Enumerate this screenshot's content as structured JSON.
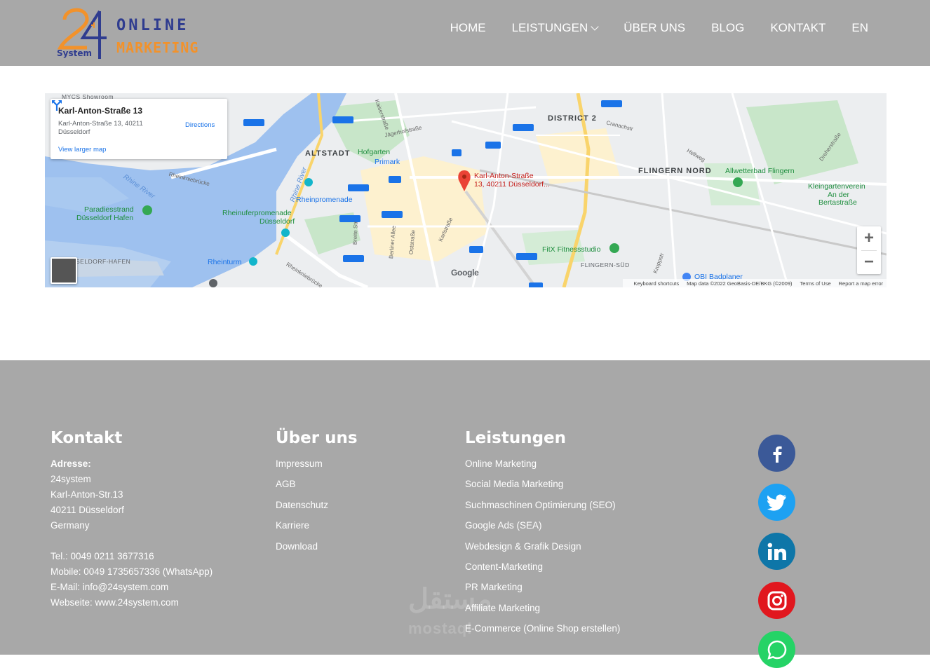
{
  "header": {
    "logo": {
      "online": "ONLINE",
      "marketing": "MARKETING",
      "system": "System",
      "number": "24"
    },
    "nav": [
      {
        "label": "HOME"
      },
      {
        "label": "LEISTUNGEN"
      },
      {
        "label": "ÜBER UNS"
      },
      {
        "label": "BLOG"
      },
      {
        "label": "KONTAKT"
      },
      {
        "label": "EN"
      }
    ]
  },
  "map": {
    "card": {
      "title": "Karl-Anton-Straße 13",
      "address_line1": "Karl-Anton-Straße 13, 40211",
      "address_line2": "Düsseldorf",
      "larger_map": "View larger map",
      "directions": "Directions"
    },
    "pin_label_1": "Karl-Anton-Straße",
    "pin_label_2": "13, 40211 Düsseldorf...",
    "labels": {
      "district2": "DISTRICT 2",
      "altstadt": "ALTSTADT",
      "flingern_nord": "FLINGERN NORD",
      "flingern_sud": "FLINGERN-SÜD",
      "hofgarten": "Hofgarten",
      "primark": "Primark",
      "rheinpromenade": "Rheinpromenade",
      "rheinuferpromenade_1": "Rheinuferpromenade",
      "rheinuferpromenade_2": "Düsseldorf",
      "paradiesstrand_1": "Paradiesstrand",
      "paradiesstrand_2": "Düsseldorf Hafen",
      "rheinturm": "Rheinturm",
      "allwetterbad": "Allwetterbad Flingern",
      "kleingarten_1": "Kleingartenverein",
      "kleingarten_2": "An der",
      "kleingarten_3": "Bertastraße",
      "fitx": "FitX Fitnessstudio",
      "obi": "OBI Badplaner",
      "rhine_river": "Rhine River",
      "rhine_river_2": "Rhine River",
      "hafen": "SELDORF-HAFEN",
      "mycs": "MYCS Showroom",
      "rheinkniebrucke": "Rheinkniebrücke",
      "rheinkniebrucke_2": "Rheinkniebrücke",
      "karlstrasse": "Karlstraße",
      "berliner_allee": "Berliner Allee",
      "oststrasse": "Oststraße",
      "breite_str": "Breite Str",
      "jaegerhof": "Jägerhofstraße",
      "kaiserstrasse": "Kaiserstraße",
      "cranachstr": "Cranachstr",
      "hellweg": "Hellweg",
      "dreherstrasse": "Dreherstraße",
      "kruppstr": "Kruppstr"
    },
    "zoom_in": "+",
    "zoom_out": "−",
    "google": "Google",
    "footer": [
      "Keyboard shortcuts",
      "Map data ©2022 GeoBasis-DE/BKG (©2009)",
      "Terms of Use",
      "Report a map error"
    ]
  },
  "footer": {
    "kontakt": {
      "heading": "Kontakt",
      "address_label": "Adresse:",
      "company": "24system",
      "street": "Karl-Anton-Str.13",
      "city": "40211 Düsseldorf",
      "country": "Germany",
      "tel": "Tel.: 0049 0211 3677316",
      "mobile": "Mobile: 0049 1735657336 (WhatsApp)",
      "email": "E-Mail: info@24system.com",
      "website": "Webseite: www.24system.com"
    },
    "ueber_uns": {
      "heading": "Über uns",
      "links": [
        "Impressum",
        "AGB",
        "Datenschutz",
        "Karriere",
        "Download"
      ]
    },
    "leistungen": {
      "heading": "Leistungen",
      "links": [
        "Online Marketing",
        "Social Media Marketing",
        "Suchmaschinen Optimierung (SEO)",
        "Google Ads (SEA)",
        "Webdesign & Grafik Design",
        "Content-Marketing",
        "PR Marketing",
        "Affiliate Marketing",
        "E-Commerce (Online Shop erstellen)"
      ]
    },
    "social": [
      {
        "icon": "facebook-icon",
        "color": "#3b5998"
      },
      {
        "icon": "twitter-icon",
        "color": "#1da1f2"
      },
      {
        "icon": "linkedin-icon",
        "color": "#0e76a8"
      },
      {
        "icon": "instagram-icon",
        "color": "#e1171e"
      },
      {
        "icon": "whatsapp-icon",
        "color": "#25d366"
      }
    ],
    "watermark": "مستقل",
    "watermark2": "mostaql"
  }
}
